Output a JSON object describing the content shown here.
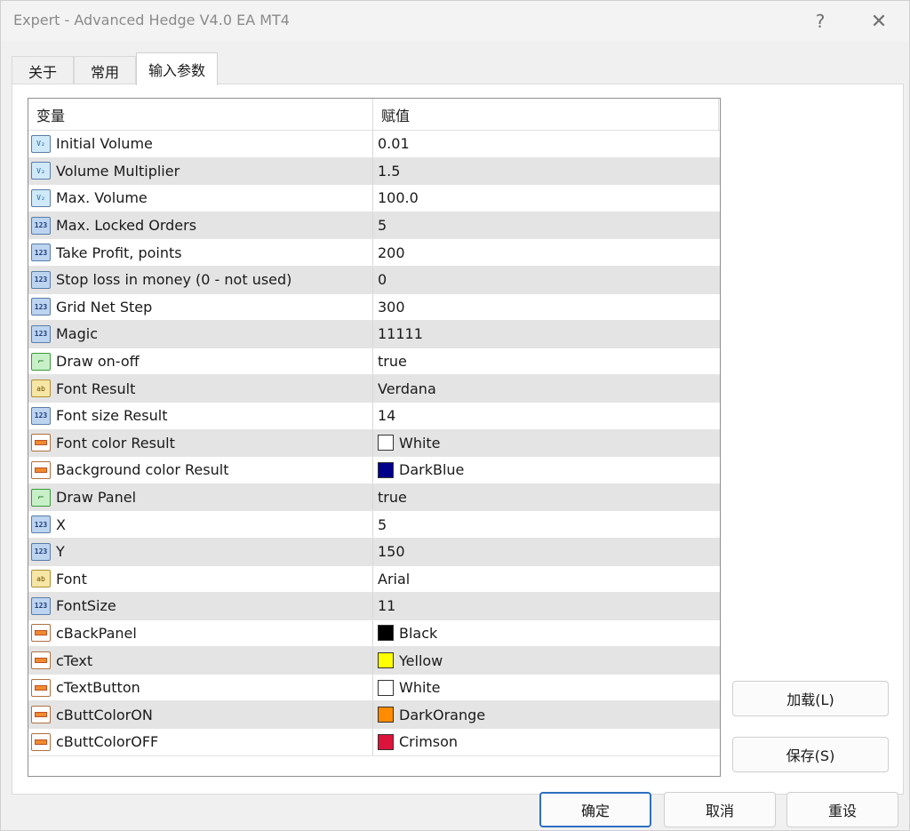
{
  "window": {
    "title": "Expert - Advanced Hedge V4.0 EA MT4",
    "help": "?",
    "close": "✕"
  },
  "tabs": [
    {
      "label": "关于"
    },
    {
      "label": "常用"
    },
    {
      "label": "输入参数"
    }
  ],
  "grid": {
    "headers": {
      "name": "变量",
      "value": "赋值"
    },
    "rows": [
      {
        "icon": "volume-icon",
        "name": "Initial Volume",
        "value": "0.01"
      },
      {
        "icon": "volume-icon",
        "name": "Volume Multiplier",
        "value": "1.5"
      },
      {
        "icon": "volume-icon",
        "name": "Max. Volume",
        "value": "100.0"
      },
      {
        "icon": "integer-icon",
        "name": "Max. Locked Orders",
        "value": "5"
      },
      {
        "icon": "integer-icon",
        "name": "Take Profit, points",
        "value": "200"
      },
      {
        "icon": "integer-icon",
        "name": "Stop loss in money (0 - not used)",
        "value": "0"
      },
      {
        "icon": "integer-icon",
        "name": "Grid Net Step",
        "value": "300"
      },
      {
        "icon": "integer-icon",
        "name": "Magic",
        "value": "11111"
      },
      {
        "icon": "bool-icon",
        "name": "Draw on-off",
        "value": "true"
      },
      {
        "icon": "string-icon",
        "name": "Font Result",
        "value": "Verdana"
      },
      {
        "icon": "integer-icon",
        "name": "Font size Result",
        "value": "14"
      },
      {
        "icon": "color-icon",
        "name": "Font color Result",
        "value": "White",
        "swatch": "#ffffff"
      },
      {
        "icon": "color-icon",
        "name": "Background color Result",
        "value": "DarkBlue",
        "swatch": "#00008b"
      },
      {
        "icon": "bool-icon",
        "name": "Draw Panel",
        "value": "true"
      },
      {
        "icon": "integer-icon",
        "name": "X",
        "value": "5"
      },
      {
        "icon": "integer-icon",
        "name": "Y",
        "value": "150"
      },
      {
        "icon": "string-icon",
        "name": "Font",
        "value": "Arial"
      },
      {
        "icon": "integer-icon",
        "name": "FontSize",
        "value": "11"
      },
      {
        "icon": "color-icon",
        "name": "cBackPanel",
        "value": "Black",
        "swatch": "#000000"
      },
      {
        "icon": "color-icon",
        "name": "cText",
        "value": "Yellow",
        "swatch": "#ffff00"
      },
      {
        "icon": "color-icon",
        "name": "cTextButton",
        "value": "White",
        "swatch": "#ffffff"
      },
      {
        "icon": "color-icon",
        "name": "cButtColorON",
        "value": "DarkOrange",
        "swatch": "#ff8c00"
      },
      {
        "icon": "color-icon",
        "name": "cButtColorOFF",
        "value": "Crimson",
        "swatch": "#dc143c"
      }
    ]
  },
  "side_buttons": {
    "load": "加载(L)",
    "save": "保存(S)"
  },
  "footer": {
    "ok": "确定",
    "cancel": "取消",
    "reset": "重设"
  },
  "colors": {
    "accent": "#2d6fc2",
    "row_alt": "#e4e4e4"
  }
}
